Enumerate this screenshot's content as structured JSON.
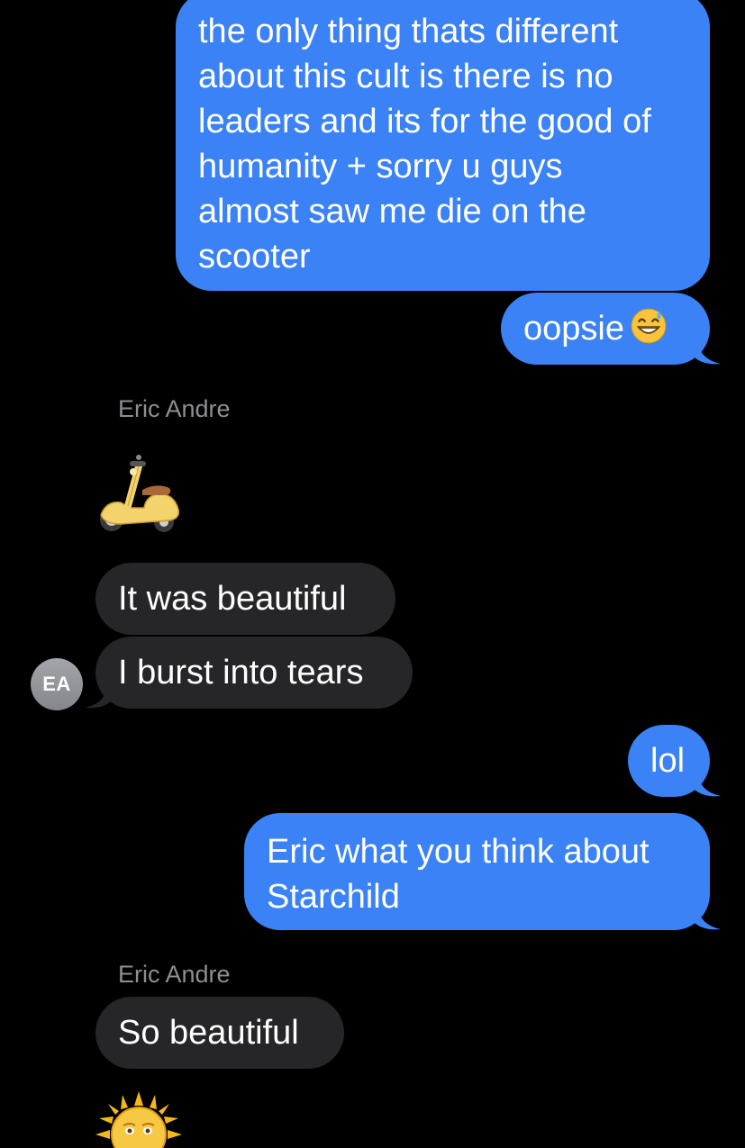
{
  "conversation": {
    "messages": [
      {
        "id": "m1",
        "direction": "outgoing",
        "text": "the only thing thats different\nabout this cult is there is no\nleaders and its for the good of\nhumanity + sorry u guys\nalmost saw me die on the\nscooter"
      },
      {
        "id": "m2",
        "direction": "outgoing",
        "text": "oopsie",
        "emoji": "grinning-face-with-sweat-emoji"
      },
      {
        "id": "m3",
        "direction": "incoming",
        "sender": "Eric Andre",
        "emoji": "motor-scooter-emoji"
      },
      {
        "id": "m4",
        "direction": "incoming",
        "text": "It was beautiful"
      },
      {
        "id": "m5",
        "direction": "incoming",
        "text": "I burst into tears"
      },
      {
        "id": "m6",
        "direction": "outgoing",
        "text": "lol"
      },
      {
        "id": "m7",
        "direction": "outgoing",
        "text": "Eric what you think about\nStarchild"
      },
      {
        "id": "m8",
        "direction": "incoming",
        "sender": "Eric Andre",
        "text": "So beautiful"
      },
      {
        "id": "m9",
        "direction": "incoming",
        "emoji": "sun-with-face-emoji"
      }
    ],
    "avatar_initials": "EA"
  },
  "colors": {
    "background": "#000000",
    "outgoing_bubble": "#3a82f5",
    "incoming_bubble": "#262628",
    "sender_name": "#8e8e93",
    "avatar": "#96979c"
  }
}
